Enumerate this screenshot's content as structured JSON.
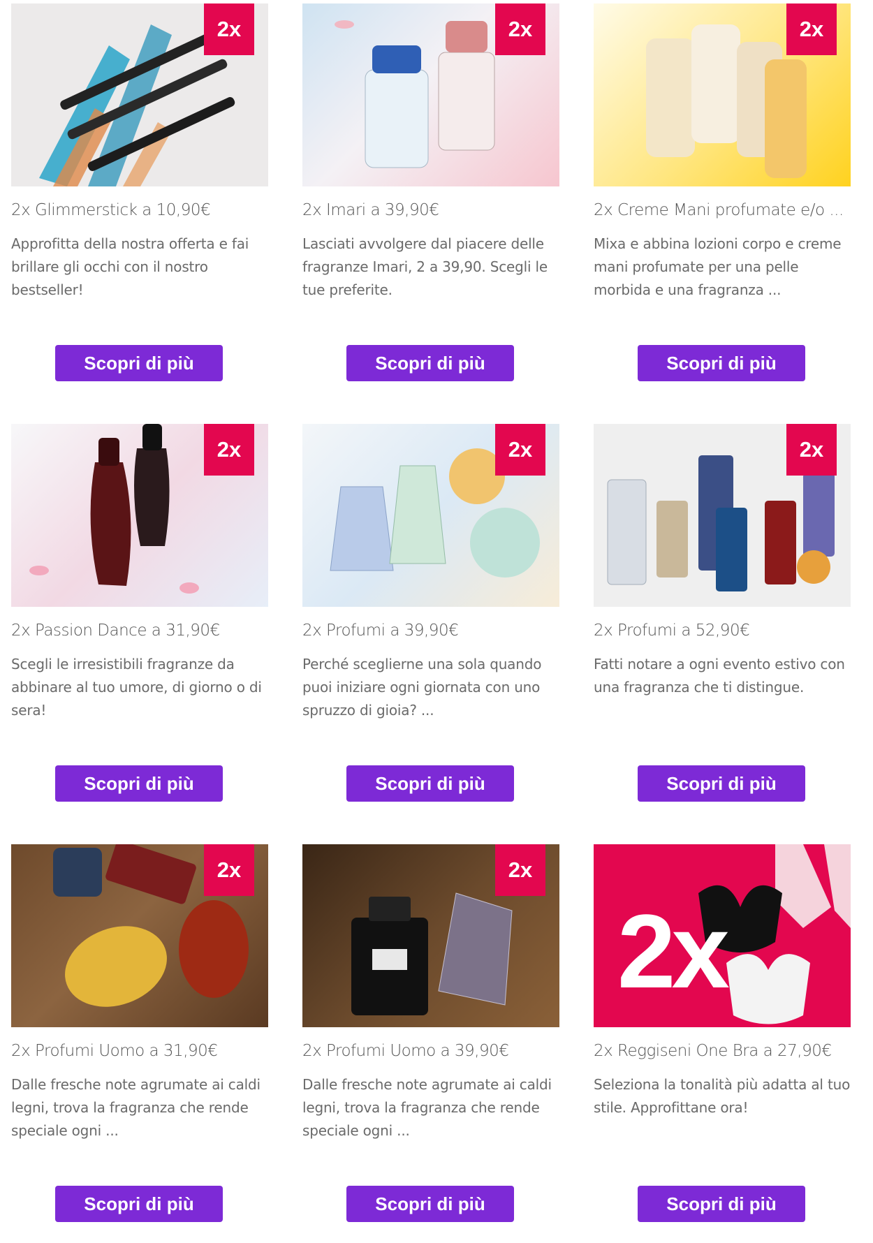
{
  "colors": {
    "badge": "#e3074f",
    "button": "#7d2ad6"
  },
  "cta_label": "Scopri di più",
  "cards": [
    {
      "badge": "2x",
      "title": "2x Glimmerstick a 10,90€",
      "description": "Approfitta della nostra offerta e fai brillare gli occhi con il nostro bestseller!",
      "image": "eyeliner-pencils-image"
    },
    {
      "badge": "2x",
      "title": "2x Imari a 39,90€",
      "description": "Lasciati avvolgere dal piacere delle fragranze Imari, 2 a 39,90. Scegli le tue preferite.",
      "image": "perfume-bottles-image"
    },
    {
      "badge": "2x",
      "title": "2x Creme Mani profumate e/o ...",
      "description": "Mixa e abbina lozioni corpo e creme mani profumate per una pelle morbida e una fragranza ...",
      "image": "hand-cream-tubes-image"
    },
    {
      "badge": "2x",
      "title": "2x Passion Dance a 31,90€",
      "description": "Scegli le irresistibili fragranze da abbinare al tuo umore, di giorno o di sera!",
      "image": "perfume-bottles-image"
    },
    {
      "badge": "2x",
      "title": "2x Profumi a 39,90€",
      "description": "Perché sceglierne una sola quando puoi iniziare ogni giornata con uno spruzzo di gioia? ...",
      "image": "perfume-bottles-image"
    },
    {
      "badge": "2x",
      "title": "2x Profumi a 52,90€",
      "description": "Fatti notare a ogni evento estivo con una fragranza che ti distingue.",
      "image": "perfume-bottles-image"
    },
    {
      "badge": "2x",
      "title": "2x Profumi Uomo a 31,90€",
      "description": "Dalle fresche note agrumate ai caldi legni, trova la fragranza che rende speciale ogni ...",
      "image": "mens-perfume-image"
    },
    {
      "badge": "2x",
      "title": "2x Profumi Uomo a 39,90€",
      "description": "Dalle fresche note agrumate ai caldi legni, trova la fragranza che rende speciale ogni ...",
      "image": "mens-perfume-image"
    },
    {
      "badge": "",
      "big_badge": "2x",
      "title": "2x Reggiseni One Bra a 27,90€",
      "description": "Seleziona la tonalità più adatta al tuo stile. Approfittane ora!",
      "image": "bras-image"
    }
  ]
}
